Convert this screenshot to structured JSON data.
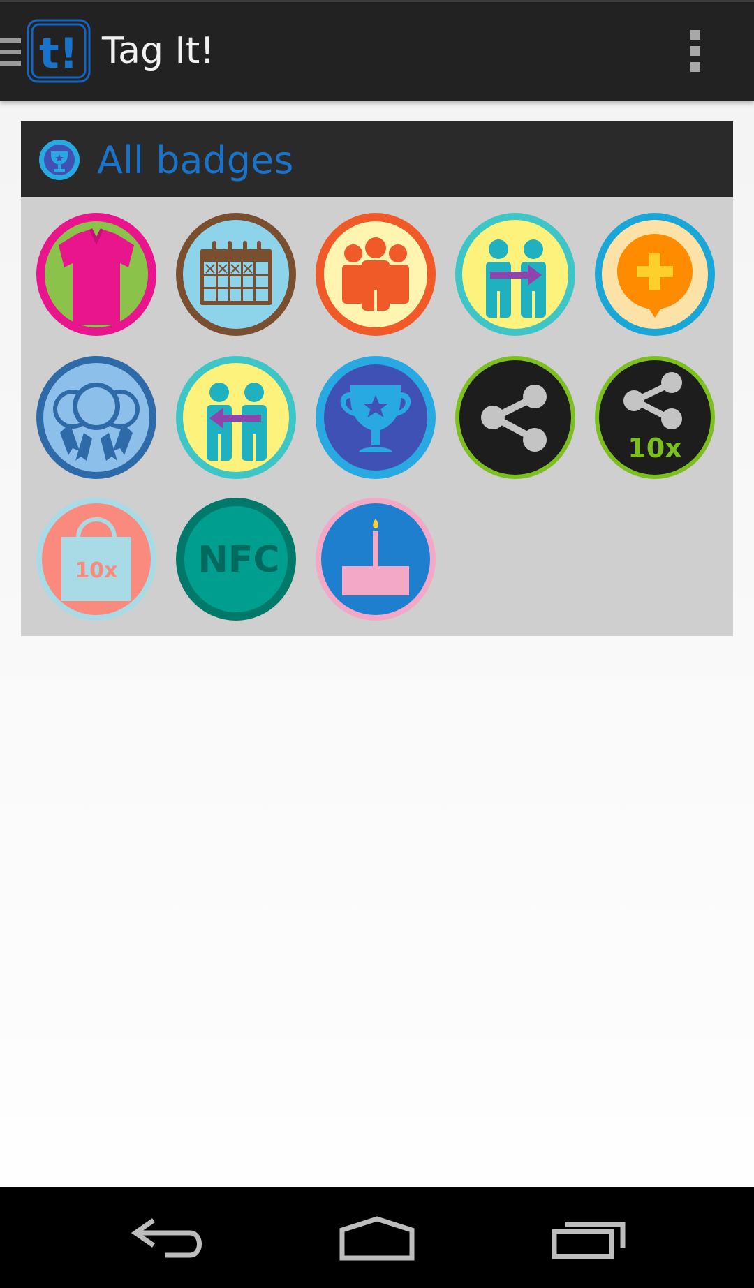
{
  "app": {
    "title": "Tag It!",
    "logo_text": "t!"
  },
  "icons": {
    "drawer": "drawer-menu-icon",
    "overflow": "overflow-menu-icon",
    "header": "trophy-icon"
  },
  "card": {
    "title": "All badges"
  },
  "badges": [
    {
      "name": "tshirt-badge",
      "icon": "tshirt-icon"
    },
    {
      "name": "calendar-badge",
      "icon": "calendar-icon"
    },
    {
      "name": "group-badge",
      "icon": "people-group-icon"
    },
    {
      "name": "transfer-out-badge",
      "icon": "people-arrow-right-icon"
    },
    {
      "name": "add-comment-badge",
      "icon": "plus-speech-bubble-icon"
    },
    {
      "name": "ribbon-badge",
      "icon": "award-ribbon-icon"
    },
    {
      "name": "transfer-in-badge",
      "icon": "people-arrow-left-icon"
    },
    {
      "name": "trophy-badge",
      "icon": "trophy-icon"
    },
    {
      "name": "share-badge",
      "icon": "share-icon"
    },
    {
      "name": "share-10x-badge",
      "icon": "share-icon",
      "label": "10x"
    },
    {
      "name": "shopping-10x-badge",
      "icon": "shopping-bag-icon",
      "label": "10x"
    },
    {
      "name": "nfc-badge",
      "icon": "nfc-icon",
      "label": "NFC"
    },
    {
      "name": "birthday-cake-badge",
      "icon": "birthday-cake-icon"
    }
  ],
  "navigation": {
    "back": "back-icon",
    "home": "home-icon",
    "recents": "recent-apps-icon"
  },
  "colors": {
    "action_bar": "#222222",
    "card_header": "#2a2a2a",
    "card_body": "#cfcfcf",
    "accent": "#1a73c8"
  }
}
